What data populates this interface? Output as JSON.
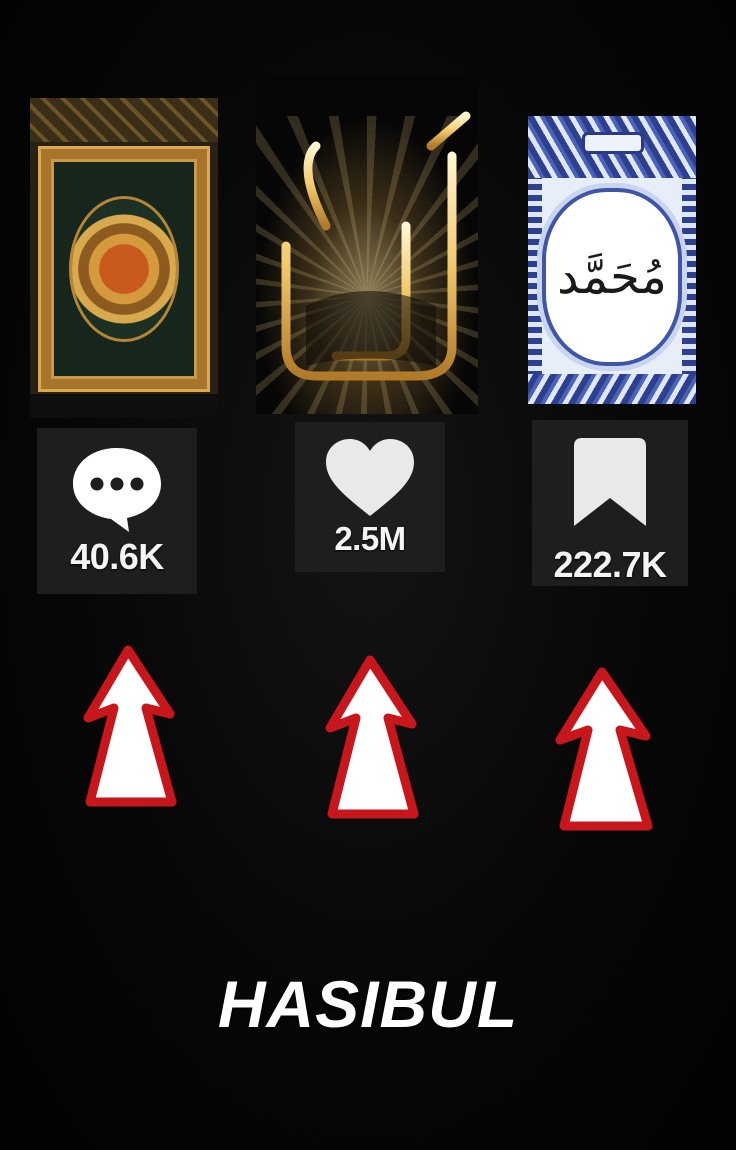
{
  "images": {
    "quran": {
      "icon": "quran-cover-image"
    },
    "allah": {
      "icon": "allah-calligraphy-image"
    },
    "muhammad": {
      "icon": "muhammad-calligraphy-image",
      "calligraphy": "مُحَمَّد"
    }
  },
  "stats": {
    "comments": {
      "icon": "comment-bubble-icon",
      "value": "40.6K"
    },
    "likes": {
      "icon": "heart-icon",
      "value": "2.5M"
    },
    "saves": {
      "icon": "bookmark-icon",
      "value": "222.7K"
    }
  },
  "arrows": {
    "icon": "up-arrow-icon",
    "count": 3,
    "stroke": "#c8161d",
    "fill": "#ffffff"
  },
  "watermark": {
    "text": "HASIBUL"
  },
  "colors": {
    "background": "#050505",
    "box": "#1e1e1e",
    "text": "#ffffff"
  }
}
